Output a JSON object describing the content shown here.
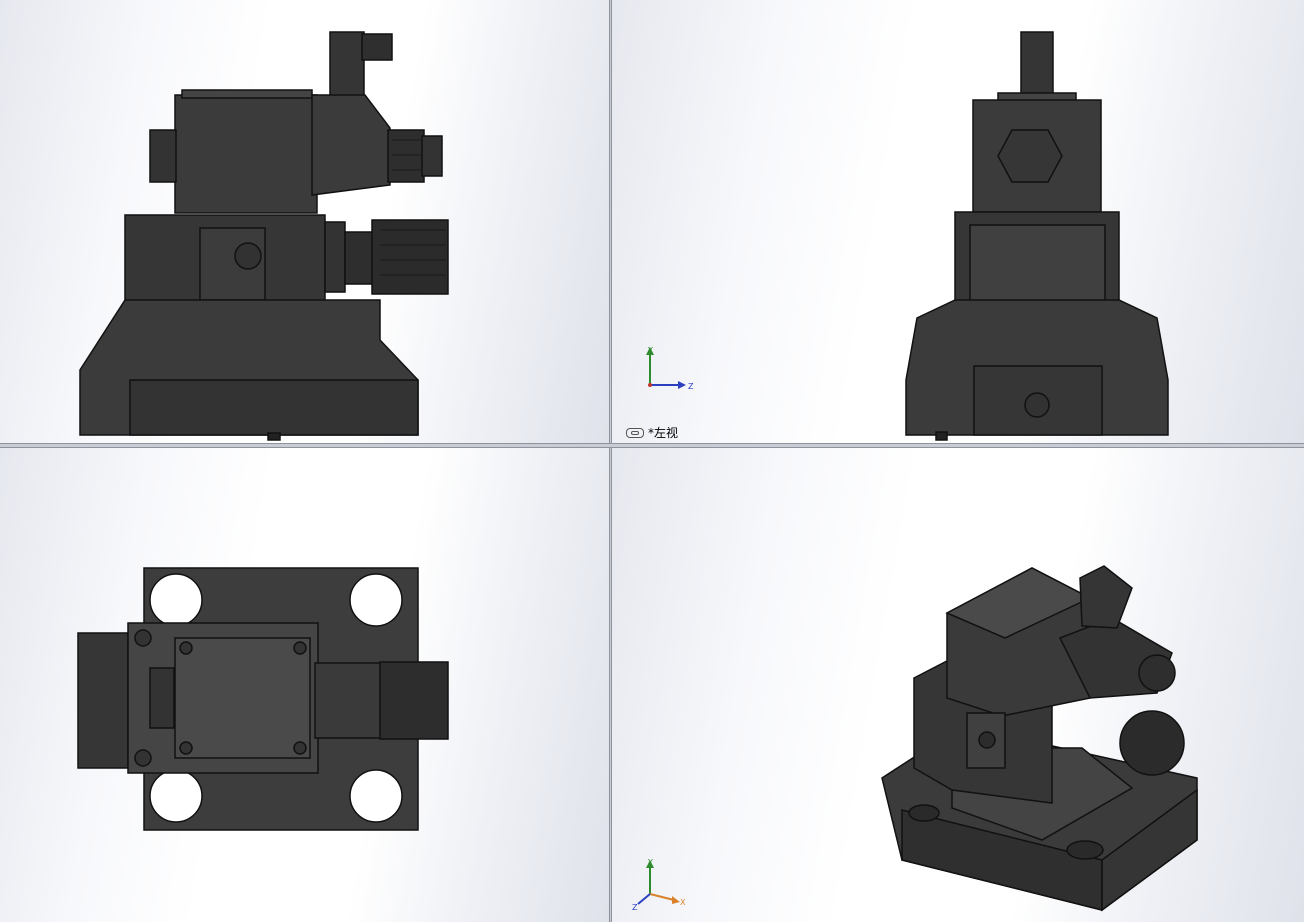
{
  "viewports": [
    {
      "id": "top-left",
      "view_label": ""
    },
    {
      "id": "top-right",
      "view_label": "*左视"
    },
    {
      "id": "bottom-left",
      "view_label": ""
    },
    {
      "id": "bottom-right",
      "view_label": ""
    }
  ],
  "triad_right": {
    "x": "",
    "y": "Y",
    "z": "Z"
  },
  "triad_iso": {
    "x": "X",
    "y": "Y",
    "z": "Z"
  },
  "colors": {
    "body": "#3a3a3a",
    "edge": "#111111",
    "x_axis": "#c0392b",
    "y_axis": "#2e8b2e",
    "z_axis": "#2b3fc0",
    "iso_x": "#d9822b"
  },
  "icons": [
    "link-icon",
    "triad-icon"
  ]
}
